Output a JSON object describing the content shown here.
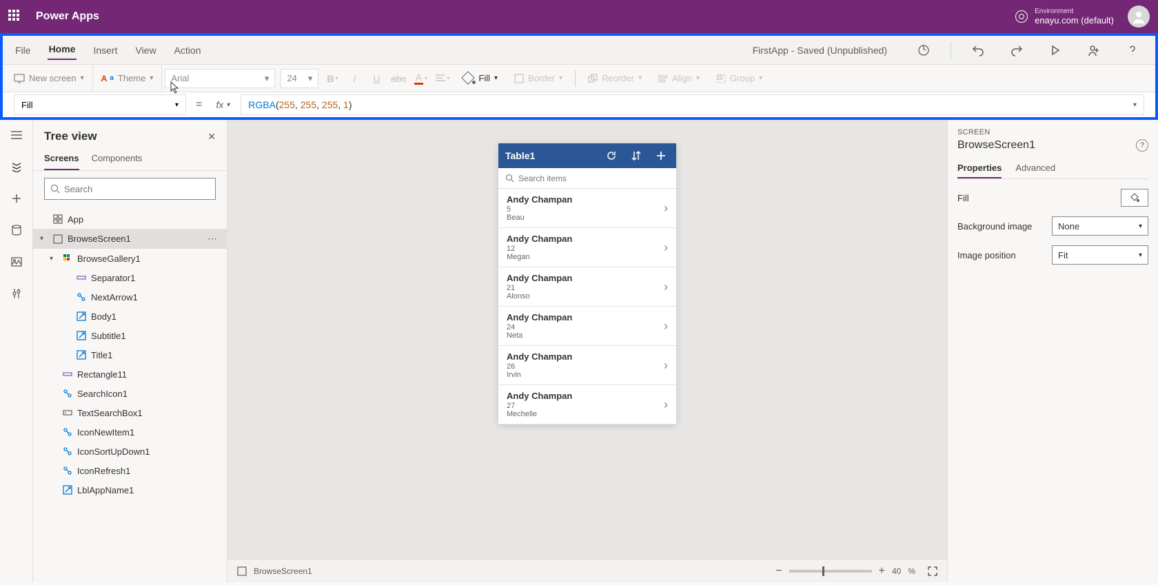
{
  "top": {
    "app_name": "Power Apps",
    "env_label": "Environment",
    "env_name": "enayu.com (default)"
  },
  "menu": {
    "items": [
      "File",
      "Home",
      "Insert",
      "View",
      "Action"
    ],
    "active": "Home",
    "status": "FirstApp - Saved (Unpublished)"
  },
  "toolbar": {
    "new_screen": "New screen",
    "theme": "Theme",
    "font": "Arial",
    "size": "24",
    "fill": "Fill",
    "border": "Border",
    "reorder": "Reorder",
    "align": "Align",
    "group": "Group"
  },
  "formula": {
    "property": "Fill",
    "fn": "RGBA",
    "args": [
      "255",
      "255",
      "255",
      "1"
    ]
  },
  "tree": {
    "title": "Tree view",
    "tabs": [
      "Screens",
      "Components"
    ],
    "active_tab": "Screens",
    "search_placeholder": "Search",
    "app_label": "App",
    "nodes": {
      "screen": "BrowseScreen1",
      "gallery": "BrowseGallery1",
      "children": [
        "Separator1",
        "NextArrow1",
        "Body1",
        "Subtitle1",
        "Title1"
      ],
      "siblings": [
        "Rectangle11",
        "SearchIcon1",
        "TextSearchBox1",
        "IconNewItem1",
        "IconSortUpDown1",
        "IconRefresh1",
        "LblAppName1"
      ]
    }
  },
  "phone": {
    "title": "Table1",
    "search_placeholder": "Search items",
    "rows": [
      {
        "title": "Andy Champan",
        "num": "5",
        "sub": "Beau"
      },
      {
        "title": "Andy Champan",
        "num": "12",
        "sub": "Megan"
      },
      {
        "title": "Andy Champan",
        "num": "21",
        "sub": "Alonso"
      },
      {
        "title": "Andy Champan",
        "num": "24",
        "sub": "Neta"
      },
      {
        "title": "Andy Champan",
        "num": "26",
        "sub": "Irvin"
      },
      {
        "title": "Andy Champan",
        "num": "27",
        "sub": "Mechelle"
      }
    ]
  },
  "footer": {
    "label": "BrowseScreen1",
    "zoom": "40",
    "pct": "%"
  },
  "props": {
    "scope": "SCREEN",
    "name": "BrowseScreen1",
    "tabs": [
      "Properties",
      "Advanced"
    ],
    "active_tab": "Properties",
    "fill_label": "Fill",
    "bg_label": "Background image",
    "bg_value": "None",
    "pos_label": "Image position",
    "pos_value": "Fit"
  }
}
